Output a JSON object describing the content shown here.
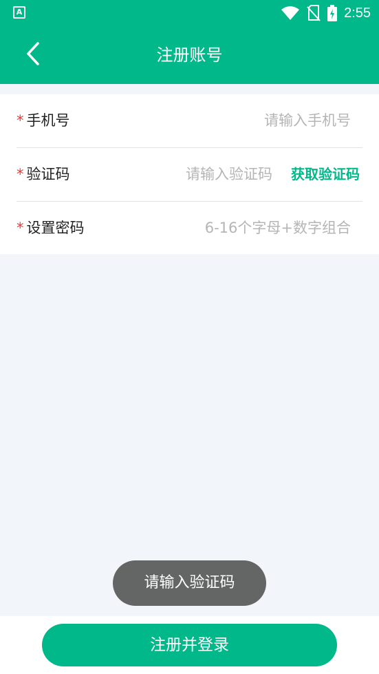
{
  "status_bar": {
    "app_icon_letter": "A",
    "time": "2:55",
    "icons": [
      "wifi-icon",
      "no-sim-icon",
      "battery-charging-icon"
    ]
  },
  "toolbar": {
    "title": "注册账号",
    "back_icon": "chevron-left-icon"
  },
  "form": {
    "required_mark": "*",
    "phone": {
      "label": "手机号",
      "placeholder": "请输入手机号",
      "value": ""
    },
    "code": {
      "label": "验证码",
      "placeholder": "请输入验证码",
      "value": "",
      "get_code_label": "获取验证码"
    },
    "password": {
      "label": "设置密码",
      "placeholder": "6-16个字母+数字组合",
      "value": ""
    }
  },
  "toast": {
    "message": "请输入验证码"
  },
  "submit": {
    "label": "注册并登录"
  },
  "colors": {
    "accent": "#00B889",
    "required": "#E53935",
    "background": "#F2F6FA",
    "toast": "#585858"
  }
}
